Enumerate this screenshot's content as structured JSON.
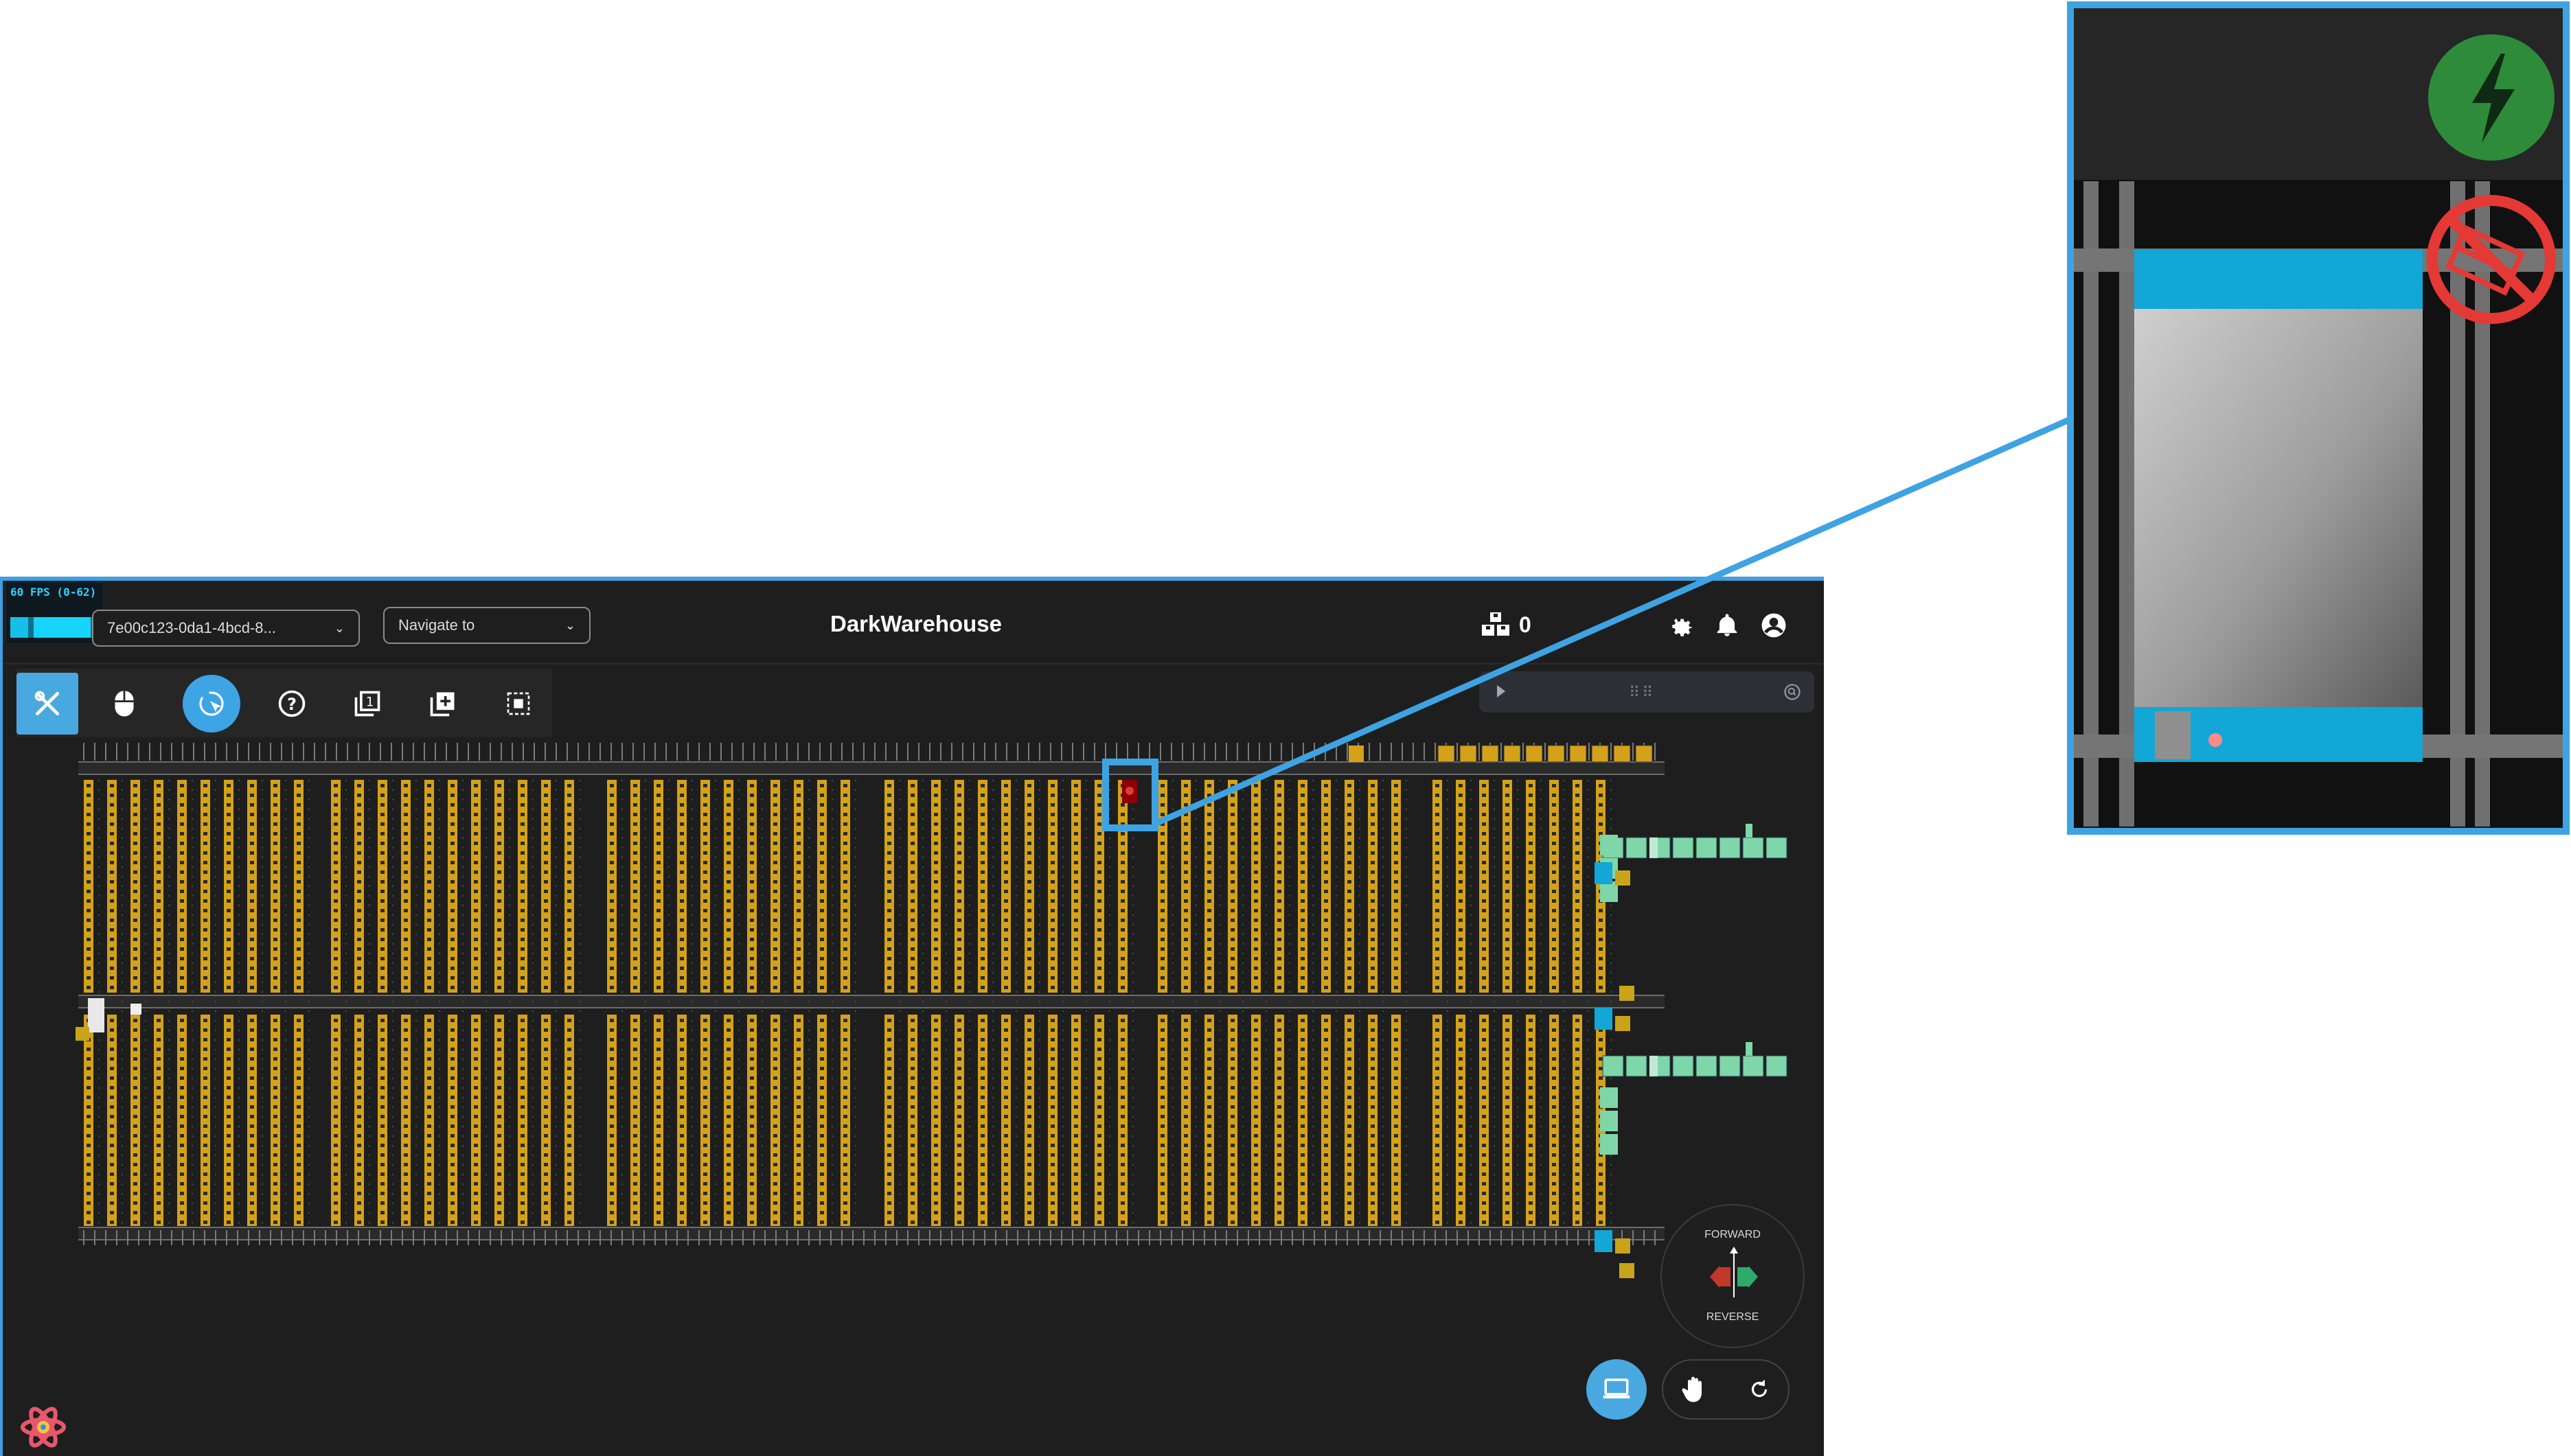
{
  "topbar": {
    "fps_label": "60 FPS (0-62)",
    "robot_select_value": "7e00c123-0da1-4bcd-8...",
    "navigate_placeholder": "Navigate to",
    "title": "DarkWarehouse",
    "orders_count": "0"
  },
  "toolbar": {
    "tools": [
      "settings-tools-icon",
      "mouse-icon",
      "cursor-target-icon",
      "help-icon",
      "layer-one-icon",
      "add-layer-icon",
      "select-area-icon"
    ]
  },
  "direction_control": {
    "forward_label": "FORWARD",
    "reverse_label": "REVERSE"
  },
  "colors": {
    "accent": "#3ea3e3",
    "background": "#1e1e1e",
    "storage_bin": "#d4a21a",
    "conveyor": "#7fd6a8",
    "charging": "#2e8b3a",
    "blocked": "#e53935"
  },
  "zoom_callout": {
    "icons": [
      "lightning-charging-icon",
      "no-entry-blocked-icon"
    ]
  }
}
